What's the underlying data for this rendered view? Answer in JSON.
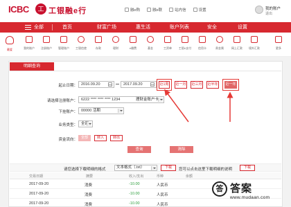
{
  "header": {
    "logo_text": "ICBC",
    "logo_seal": "工",
    "logo_cn": "工银融e行",
    "top_links": [
      "融e购",
      "融e联",
      "站内信",
      "设置"
    ],
    "user_name": "我的账户",
    "user_sub": "退出"
  },
  "nav": {
    "items": [
      "全部",
      "首页",
      "财富广场",
      "惠生活",
      "账户列表",
      "安全",
      "设置"
    ]
  },
  "shortcuts": [
    {
      "label": "最爱",
      "icon": "heart-icon"
    },
    {
      "label": "我的账户",
      "icon": "account-icon"
    },
    {
      "label": "注册账户",
      "icon": "register-icon"
    },
    {
      "label": "管理账户",
      "icon": "manage-icon"
    },
    {
      "label": "工银信使",
      "icon": "messenger-icon"
    },
    {
      "label": "存款",
      "icon": "deposit-icon"
    },
    {
      "label": "理财",
      "icon": "finance-icon"
    },
    {
      "label": "e缴费",
      "icon": "payment-icon"
    },
    {
      "label": "基金",
      "icon": "fund-icon"
    },
    {
      "label": "工资单",
      "icon": "payroll-icon"
    },
    {
      "label": "工银e支付",
      "icon": "epay-icon"
    },
    {
      "label": "信用卡",
      "icon": "card-icon"
    },
    {
      "label": "贵金属",
      "icon": "gold-icon"
    },
    {
      "label": "网上汇款",
      "icon": "transfer-icon"
    },
    {
      "label": "境外汇款",
      "icon": "overseas-icon"
    },
    {
      "label": "更多",
      "icon": "more-icon"
    }
  ],
  "panel": {
    "tab_label": "明细查询"
  },
  "form": {
    "date_label": "起止日期：",
    "start_date": "2016.09.20",
    "end_date": "2017.09.20",
    "quick_buttons": [
      "近1周",
      "近一月",
      "近三月",
      "近半年",
      "近一年"
    ],
    "account_label": "请选择注册账户：",
    "account_value": "6222 **** **** **** 1234",
    "account_type": "理财金账户卡",
    "sub_account_label": "下挂账户：",
    "sub_account_value": "00000 活期",
    "business_type_label": "业务类型：",
    "business_type_value": "全部",
    "flow_label": "资金流向：",
    "flow_options": [
      "全部",
      "转入",
      "转出"
    ],
    "query_button": "查询",
    "clear_button": "清除"
  },
  "download": {
    "label": "请您选择下载明细的格式",
    "format_value": "文本格式（.txt）",
    "download_button": "下载",
    "note": "您可以点击这里下载明细的说明",
    "note_button": "下载"
  },
  "table": {
    "headers": [
      "交易日期",
      "摘要",
      "收入/支出",
      "币种",
      "余额"
    ],
    "rows": [
      {
        "date": "2017-09-20",
        "summary": "消费",
        "amount": "-10.00",
        "currency": "人民币"
      },
      {
        "date": "2017-09-20",
        "summary": "消费",
        "amount": "-10.00",
        "currency": "人民币"
      },
      {
        "date": "2017-09-20",
        "summary": "消费",
        "amount": "-10.00",
        "currency": "人民币"
      }
    ]
  },
  "watermark": {
    "glyph": "答",
    "text": "答案",
    "url": "www.mudaan.com"
  },
  "colors": {
    "brand_red": "#d7282f",
    "amount_green": "#2e9e3e",
    "annotation_red": "#e53935"
  }
}
